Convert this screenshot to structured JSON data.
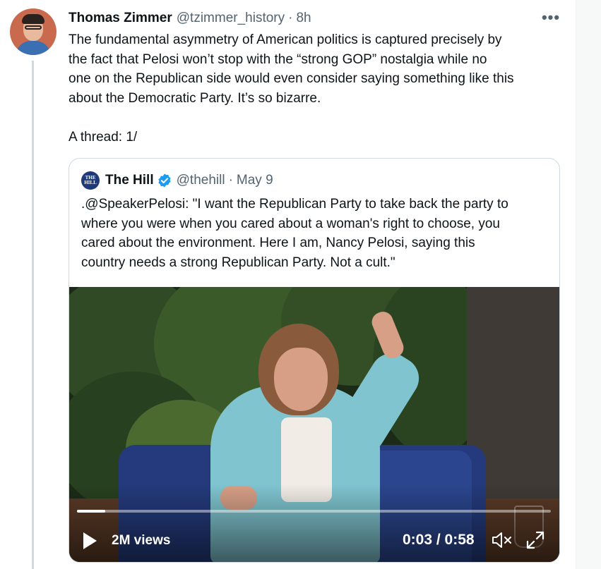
{
  "tweet": {
    "author_name": "Thomas Zimmer",
    "author_handle": "@tzimmer_history",
    "separator": "·",
    "time": "8h",
    "more_glyph": "•••",
    "text_lines": [
      "The fundamental asymmetry of American politics is captured precisely by",
      "the fact that Pelosi won’t stop with the “strong GOP” nostalgia while no",
      "one on the Republican side would even consider saying something like this",
      "about the Democratic Party. It’s so bizarre."
    ],
    "text_lines_2": [
      "A thread: 1/"
    ]
  },
  "quote": {
    "logo_text": "THE HILL",
    "name": "The Hill",
    "verified": true,
    "handle": "@thehill",
    "separator": "·",
    "date": "May 9",
    "text_lines": [
      ".@SpeakerPelosi: \"I want the Republican Party to take back the party to",
      "where you were when you cared about a woman's right to choose, you",
      "cared about the environment. Here I am, Nancy Pelosi, saying this",
      "country needs a strong Republican Party. Not a cult.\""
    ]
  },
  "video": {
    "views": "2M views",
    "timecode": "0:03 / 0:58",
    "progress": 0.06,
    "muted": true
  },
  "colors": {
    "text_primary": "#0f1419",
    "text_secondary": "#536471",
    "verified_blue": "#1d9bf0",
    "border": "#cfd9de"
  },
  "icons": {
    "more": "more-icon",
    "verified": "verified-badge-icon",
    "play": "play-icon",
    "mute": "muted-speaker-icon",
    "fullscreen": "fullscreen-icon"
  }
}
